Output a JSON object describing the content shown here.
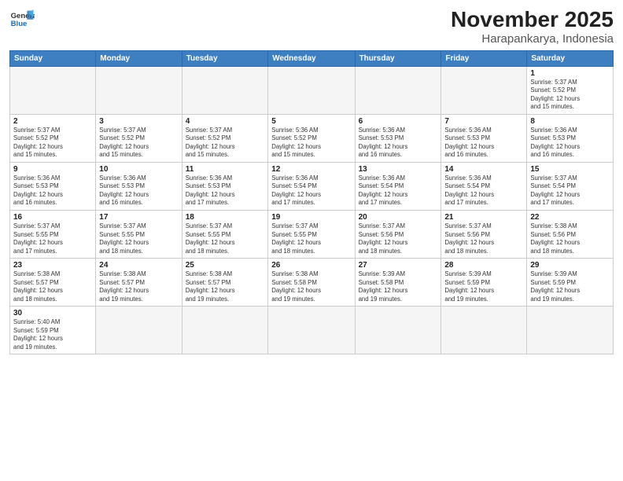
{
  "header": {
    "logo_general": "General",
    "logo_blue": "Blue",
    "title": "November 2025",
    "subtitle": "Harapankarya, Indonesia"
  },
  "weekdays": [
    "Sunday",
    "Monday",
    "Tuesday",
    "Wednesday",
    "Thursday",
    "Friday",
    "Saturday"
  ],
  "weeks": [
    [
      {
        "day": "",
        "info": ""
      },
      {
        "day": "",
        "info": ""
      },
      {
        "day": "",
        "info": ""
      },
      {
        "day": "",
        "info": ""
      },
      {
        "day": "",
        "info": ""
      },
      {
        "day": "",
        "info": ""
      },
      {
        "day": "1",
        "info": "Sunrise: 5:37 AM\nSunset: 5:52 PM\nDaylight: 12 hours\nand 15 minutes."
      }
    ],
    [
      {
        "day": "2",
        "info": "Sunrise: 5:37 AM\nSunset: 5:52 PM\nDaylight: 12 hours\nand 15 minutes."
      },
      {
        "day": "3",
        "info": "Sunrise: 5:37 AM\nSunset: 5:52 PM\nDaylight: 12 hours\nand 15 minutes."
      },
      {
        "day": "4",
        "info": "Sunrise: 5:37 AM\nSunset: 5:52 PM\nDaylight: 12 hours\nand 15 minutes."
      },
      {
        "day": "5",
        "info": "Sunrise: 5:36 AM\nSunset: 5:52 PM\nDaylight: 12 hours\nand 15 minutes."
      },
      {
        "day": "6",
        "info": "Sunrise: 5:36 AM\nSunset: 5:53 PM\nDaylight: 12 hours\nand 16 minutes."
      },
      {
        "day": "7",
        "info": "Sunrise: 5:36 AM\nSunset: 5:53 PM\nDaylight: 12 hours\nand 16 minutes."
      },
      {
        "day": "8",
        "info": "Sunrise: 5:36 AM\nSunset: 5:53 PM\nDaylight: 12 hours\nand 16 minutes."
      }
    ],
    [
      {
        "day": "9",
        "info": "Sunrise: 5:36 AM\nSunset: 5:53 PM\nDaylight: 12 hours\nand 16 minutes."
      },
      {
        "day": "10",
        "info": "Sunrise: 5:36 AM\nSunset: 5:53 PM\nDaylight: 12 hours\nand 16 minutes."
      },
      {
        "day": "11",
        "info": "Sunrise: 5:36 AM\nSunset: 5:53 PM\nDaylight: 12 hours\nand 17 minutes."
      },
      {
        "day": "12",
        "info": "Sunrise: 5:36 AM\nSunset: 5:54 PM\nDaylight: 12 hours\nand 17 minutes."
      },
      {
        "day": "13",
        "info": "Sunrise: 5:36 AM\nSunset: 5:54 PM\nDaylight: 12 hours\nand 17 minutes."
      },
      {
        "day": "14",
        "info": "Sunrise: 5:36 AM\nSunset: 5:54 PM\nDaylight: 12 hours\nand 17 minutes."
      },
      {
        "day": "15",
        "info": "Sunrise: 5:37 AM\nSunset: 5:54 PM\nDaylight: 12 hours\nand 17 minutes."
      }
    ],
    [
      {
        "day": "16",
        "info": "Sunrise: 5:37 AM\nSunset: 5:55 PM\nDaylight: 12 hours\nand 17 minutes."
      },
      {
        "day": "17",
        "info": "Sunrise: 5:37 AM\nSunset: 5:55 PM\nDaylight: 12 hours\nand 18 minutes."
      },
      {
        "day": "18",
        "info": "Sunrise: 5:37 AM\nSunset: 5:55 PM\nDaylight: 12 hours\nand 18 minutes."
      },
      {
        "day": "19",
        "info": "Sunrise: 5:37 AM\nSunset: 5:55 PM\nDaylight: 12 hours\nand 18 minutes."
      },
      {
        "day": "20",
        "info": "Sunrise: 5:37 AM\nSunset: 5:56 PM\nDaylight: 12 hours\nand 18 minutes."
      },
      {
        "day": "21",
        "info": "Sunrise: 5:37 AM\nSunset: 5:56 PM\nDaylight: 12 hours\nand 18 minutes."
      },
      {
        "day": "22",
        "info": "Sunrise: 5:38 AM\nSunset: 5:56 PM\nDaylight: 12 hours\nand 18 minutes."
      }
    ],
    [
      {
        "day": "23",
        "info": "Sunrise: 5:38 AM\nSunset: 5:57 PM\nDaylight: 12 hours\nand 18 minutes."
      },
      {
        "day": "24",
        "info": "Sunrise: 5:38 AM\nSunset: 5:57 PM\nDaylight: 12 hours\nand 19 minutes."
      },
      {
        "day": "25",
        "info": "Sunrise: 5:38 AM\nSunset: 5:57 PM\nDaylight: 12 hours\nand 19 minutes."
      },
      {
        "day": "26",
        "info": "Sunrise: 5:38 AM\nSunset: 5:58 PM\nDaylight: 12 hours\nand 19 minutes."
      },
      {
        "day": "27",
        "info": "Sunrise: 5:39 AM\nSunset: 5:58 PM\nDaylight: 12 hours\nand 19 minutes."
      },
      {
        "day": "28",
        "info": "Sunrise: 5:39 AM\nSunset: 5:59 PM\nDaylight: 12 hours\nand 19 minutes."
      },
      {
        "day": "29",
        "info": "Sunrise: 5:39 AM\nSunset: 5:59 PM\nDaylight: 12 hours\nand 19 minutes."
      }
    ],
    [
      {
        "day": "30",
        "info": "Sunrise: 5:40 AM\nSunset: 5:59 PM\nDaylight: 12 hours\nand 19 minutes."
      },
      {
        "day": "",
        "info": ""
      },
      {
        "day": "",
        "info": ""
      },
      {
        "day": "",
        "info": ""
      },
      {
        "day": "",
        "info": ""
      },
      {
        "day": "",
        "info": ""
      },
      {
        "day": "",
        "info": ""
      }
    ]
  ]
}
